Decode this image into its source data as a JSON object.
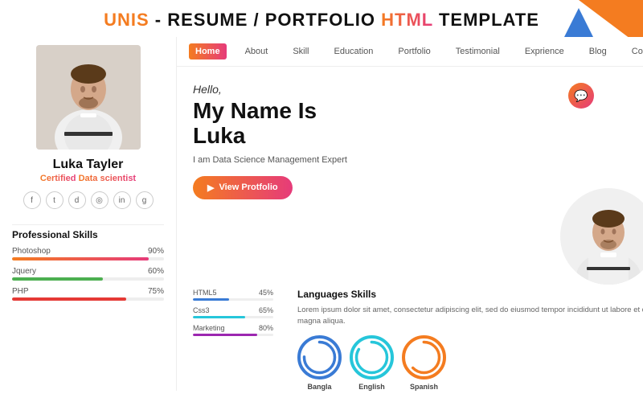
{
  "header": {
    "title_part1": "UNIS",
    "title_part2": " - RESUME / PORTFOLIO ",
    "title_part3": "HTML",
    "title_part4": " TEMPLATE"
  },
  "nav": {
    "items": [
      "Home",
      "About",
      "Skill",
      "Education",
      "Portfolio",
      "Testimonial",
      "Exprience",
      "Blog",
      "Contact"
    ],
    "active": "Home"
  },
  "sidebar": {
    "name": "Luka Tayler",
    "title_certified": "Certified",
    "title_role": " Data scientist",
    "social_icons": [
      "f",
      "t",
      "in",
      "ig",
      "li",
      "g"
    ]
  },
  "professional_skills": {
    "title": "Professional Skills",
    "items": [
      {
        "label": "Photoshop",
        "percent": "90%",
        "color": "orange"
      },
      {
        "label": "Jquery",
        "percent": "60%",
        "color": "green"
      },
      {
        "label": "PHP",
        "percent": "75%",
        "color": "red"
      }
    ]
  },
  "hero": {
    "hello": "Hello,",
    "name_line1": "My Name Is",
    "name_line2": "Luka",
    "subtitle": "I am Data Science Management Expert",
    "btn_label": "View Protfolio"
  },
  "main_skills": {
    "col1": [
      {
        "label": "HTML5",
        "percent": "45%",
        "color": "blue"
      },
      {
        "label": "Css3",
        "percent": "65%",
        "color": "teal"
      },
      {
        "label": "Marketing",
        "percent": "80%",
        "color": "purple"
      }
    ]
  },
  "languages": {
    "title": "Languages Skills",
    "text": "Lorem ipsum dolor sit amet, consectetur adipiscing elit, sed do eiusmod tempor incididunt ut labore et dolore magna aliqua.",
    "items": [
      {
        "label": "Bangla",
        "color": "blue"
      },
      {
        "label": "English",
        "color": "teal"
      },
      {
        "label": "Spanish",
        "color": "orange"
      }
    ]
  }
}
